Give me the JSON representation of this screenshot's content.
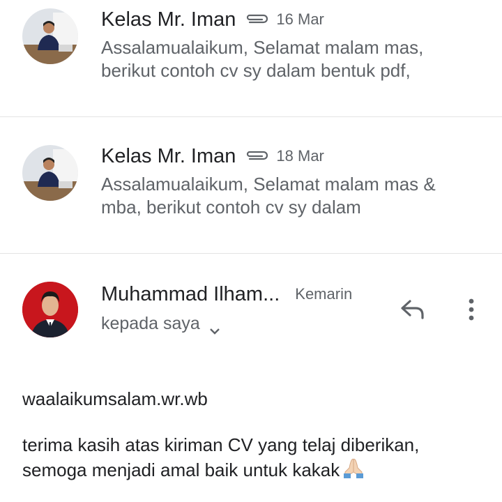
{
  "messages": [
    {
      "sender": "Kelas Mr. Iman",
      "date": "16 Mar",
      "has_attachment": true,
      "snippet": "Assalamualaikum, Selamat malam mas, berikut contoh cv sy dalam bentuk pdf,"
    },
    {
      "sender": "Kelas Mr. Iman",
      "date": "18 Mar",
      "has_attachment": true,
      "snippet": "Assalamualaikum, Selamat malam mas & mba, berikut contoh cv sy dalam"
    }
  ],
  "open_message": {
    "sender": "Muhammad Ilham...",
    "date": "Kemarin",
    "recipient": "kepada saya",
    "body": {
      "line1": "waalaikumsalam.wr.wb",
      "line2": "terima kasih atas kiriman CV yang telaj diberikan,",
      "line3": "semoga menjadi amal baik untuk kakak"
    }
  },
  "icons": {
    "attachment": "paperclip-icon",
    "reply": "reply-icon",
    "more": "more-vert-icon",
    "expand": "chevron-down-icon",
    "emoji": "folded-hands-emoji"
  },
  "colors": {
    "primary_text": "#202124",
    "secondary_text": "#5f6368",
    "divider": "#e3e3e3",
    "avatar_bg_2": "#c8161d"
  }
}
